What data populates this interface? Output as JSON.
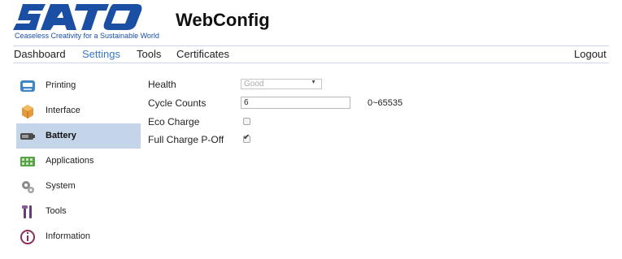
{
  "header": {
    "logo_text": "SATO",
    "tagline": "Ceaseless Creativity for a Sustainable World",
    "title": "WebConfig",
    "brand_color": "#1a4fa3"
  },
  "nav": {
    "items": [
      "Dashboard",
      "Settings",
      "Tools",
      "Certificates"
    ],
    "active": "Settings",
    "logout": "Logout",
    "active_color": "#3b78c4"
  },
  "sidebar": {
    "items": [
      {
        "label": "Printing",
        "icon": "printer-icon"
      },
      {
        "label": "Interface",
        "icon": "interface-box-icon"
      },
      {
        "label": "Battery",
        "icon": "battery-icon"
      },
      {
        "label": "Applications",
        "icon": "applications-grid-icon"
      },
      {
        "label": "System",
        "icon": "gears-icon"
      },
      {
        "label": "Tools",
        "icon": "tools-icon"
      },
      {
        "label": "Information",
        "icon": "information-icon"
      }
    ],
    "active_index": 2,
    "active_bg": "#c4d5ea"
  },
  "form": {
    "health": {
      "label": "Health",
      "value": "Good"
    },
    "cycle_counts": {
      "label": "Cycle Counts",
      "value": "6",
      "range": "0~65535"
    },
    "eco_charge": {
      "label": "Eco Charge",
      "checked": false
    },
    "full_charge": {
      "label": "Full Charge P-Off",
      "checked": true
    }
  }
}
